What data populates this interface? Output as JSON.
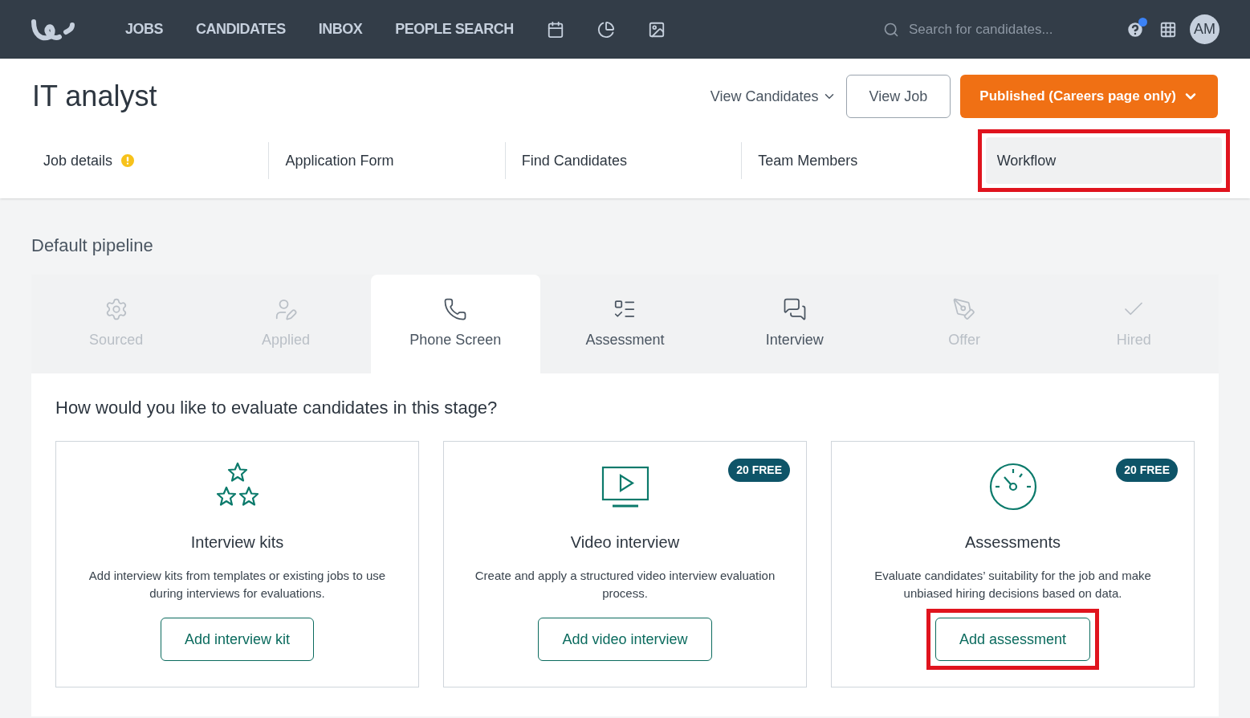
{
  "nav": {
    "items": [
      "JOBS",
      "CANDIDATES",
      "INBOX",
      "PEOPLE SEARCH"
    ],
    "search": {
      "placeholder": "Search for candidates..."
    },
    "help_notification": true,
    "avatar": "AM"
  },
  "job": {
    "title": "IT analyst",
    "view_candidates": "View Candidates",
    "view_job": "View Job",
    "status": "Published (Careers page only)"
  },
  "tabs": [
    {
      "label": "Job details",
      "selected": false,
      "warning": true,
      "highlighted": false
    },
    {
      "label": "Application Form",
      "selected": false,
      "warning": false,
      "highlighted": false
    },
    {
      "label": "Find Candidates",
      "selected": false,
      "warning": false,
      "highlighted": false
    },
    {
      "label": "Team Members",
      "selected": false,
      "warning": false,
      "highlighted": false
    },
    {
      "label": "Workflow",
      "selected": true,
      "warning": false,
      "highlighted": true
    }
  ],
  "pipeline": {
    "title": "Default pipeline",
    "stages": [
      {
        "kind": "sourced",
        "label": "Sourced",
        "selected": false,
        "disabled": true
      },
      {
        "kind": "applied",
        "label": "Applied",
        "selected": false,
        "disabled": true
      },
      {
        "kind": "phone",
        "label": "Phone Screen",
        "selected": true,
        "disabled": false
      },
      {
        "kind": "assessment",
        "label": "Assessment",
        "selected": false,
        "disabled": false
      },
      {
        "kind": "interview",
        "label": "Interview",
        "selected": false,
        "disabled": false
      },
      {
        "kind": "offer",
        "label": "Offer",
        "selected": false,
        "disabled": true
      },
      {
        "kind": "hired",
        "label": "Hired",
        "selected": false,
        "disabled": true
      }
    ]
  },
  "question": "How would you like to evaluate candidates in this stage?",
  "cards": [
    {
      "kind": "kits",
      "title": "Interview kits",
      "description": "Add interview kits from templates or existing jobs to use during interviews for evaluations.",
      "button": "Add interview kit",
      "button_highlighted": false
    },
    {
      "kind": "video",
      "badge": "20 FREE",
      "title": "Video interview",
      "description": "Create and apply a structured video interview evaluation process.",
      "button": "Add video interview",
      "button_highlighted": false
    },
    {
      "kind": "gauge",
      "badge": "20 FREE",
      "title": "Assessments",
      "description": "Evaluate candidates’ suitability for the job and make unbiased hiring decisions based on data.",
      "button": "Add assessment",
      "button_highlighted": true
    }
  ]
}
